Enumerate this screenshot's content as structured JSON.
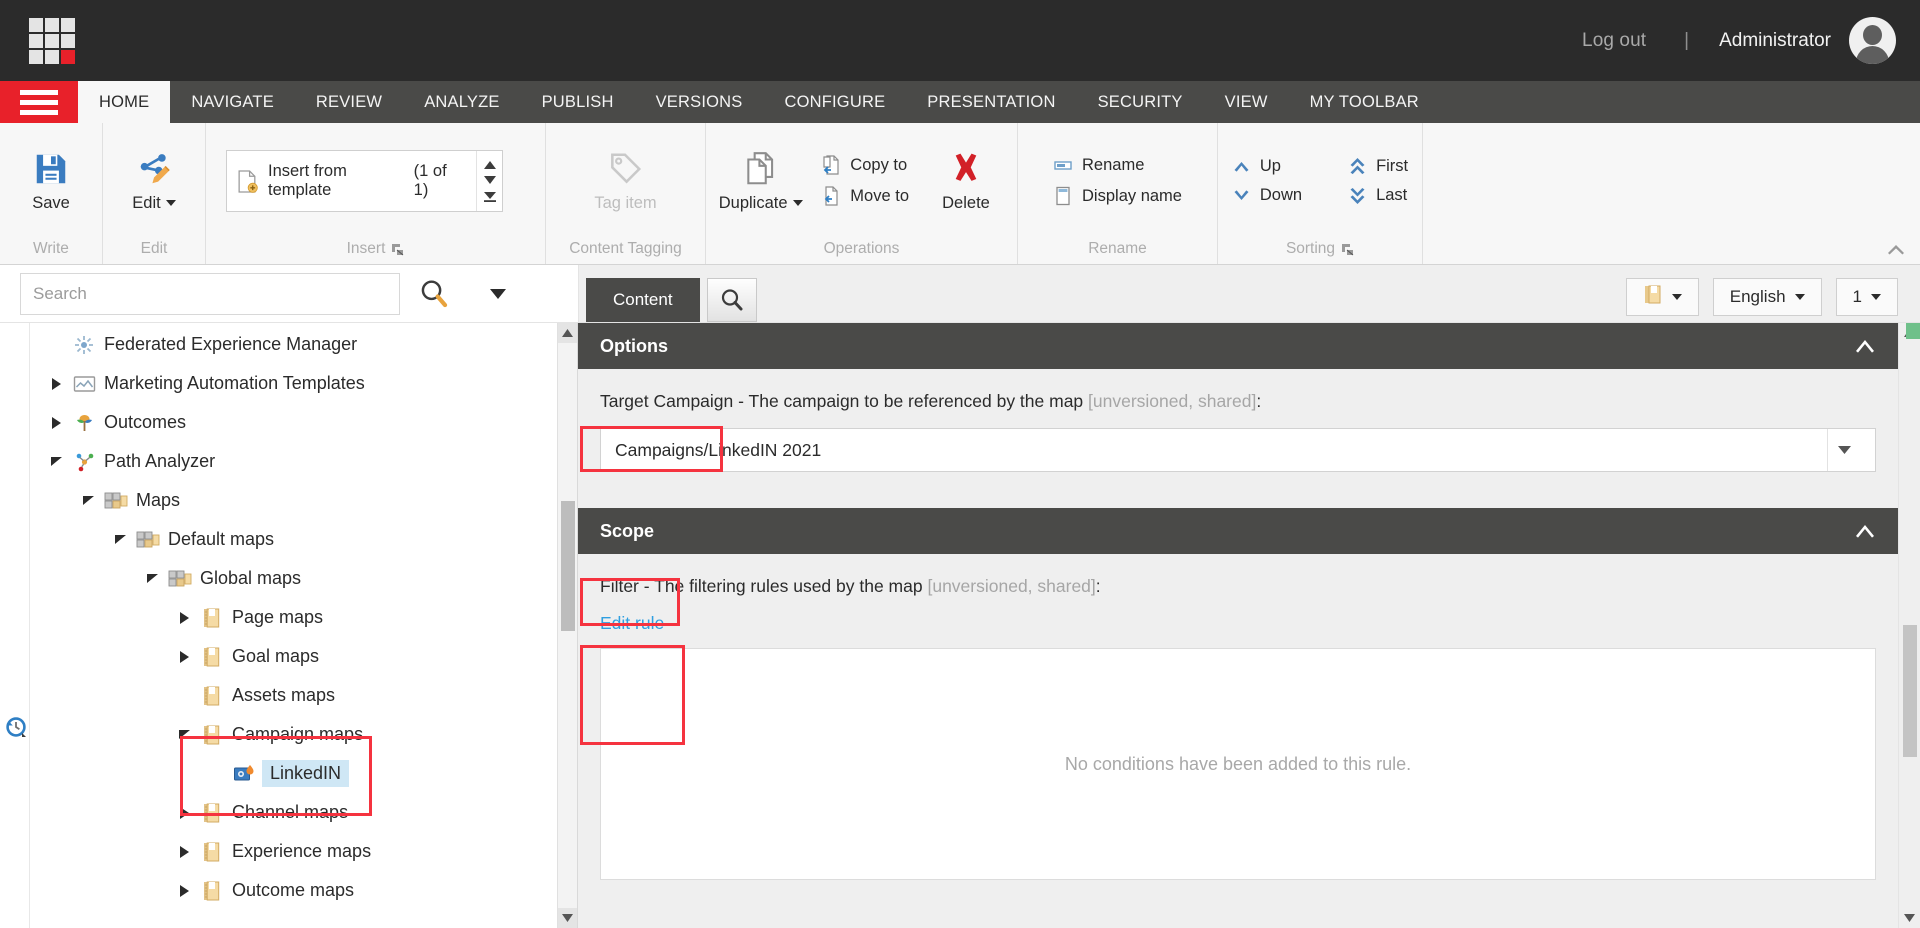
{
  "topbar": {
    "logo_name": "sitecore-logo",
    "logout_label": "Log out",
    "separator": "|",
    "user_label": "Administrator"
  },
  "ribbon_tabs": [
    {
      "label": "HOME",
      "active": true
    },
    {
      "label": "NAVIGATE",
      "active": false
    },
    {
      "label": "REVIEW",
      "active": false
    },
    {
      "label": "ANALYZE",
      "active": false
    },
    {
      "label": "PUBLISH",
      "active": false
    },
    {
      "label": "VERSIONS",
      "active": false
    },
    {
      "label": "CONFIGURE",
      "active": false
    },
    {
      "label": "PRESENTATION",
      "active": false
    },
    {
      "label": "SECURITY",
      "active": false
    },
    {
      "label": "VIEW",
      "active": false
    },
    {
      "label": "MY TOOLBAR",
      "active": false
    }
  ],
  "ribbon": {
    "write": {
      "group_label": "Write",
      "save_label": "Save"
    },
    "edit": {
      "group_label": "Edit",
      "edit_label": "Edit"
    },
    "insert": {
      "group_label": "Insert",
      "template_label": "Insert from template",
      "counter": "(1 of 1)"
    },
    "content_tagging": {
      "group_label": "Content Tagging",
      "tag_item_label": "Tag item"
    },
    "operations": {
      "group_label": "Operations",
      "duplicate_label": "Duplicate",
      "copy_to_label": "Copy to",
      "move_to_label": "Move to",
      "delete_label": "Delete"
    },
    "rename": {
      "group_label": "Rename",
      "rename_label": "Rename",
      "display_name_label": "Display name"
    },
    "sorting": {
      "group_label": "Sorting",
      "up_label": "Up",
      "down_label": "Down",
      "first_label": "First",
      "last_label": "Last"
    }
  },
  "search": {
    "placeholder": "Search",
    "value": ""
  },
  "content_tabs": {
    "content_label": "Content",
    "search_icon": "search-icon"
  },
  "header_controls": {
    "item_dropdown": "",
    "language_label": "English",
    "version_label": "1"
  },
  "tree": {
    "items": [
      {
        "label": "Federated Experience Manager",
        "depth": 1,
        "twist": "none",
        "icon": "fxm-icon",
        "selected": false
      },
      {
        "label": "Marketing Automation Templates",
        "depth": 1,
        "twist": "collapsed",
        "icon": "ma-icon",
        "selected": false
      },
      {
        "label": "Outcomes",
        "depth": 1,
        "twist": "collapsed",
        "icon": "outcomes-icon",
        "selected": false
      },
      {
        "label": "Path Analyzer",
        "depth": 1,
        "twist": "expanded",
        "icon": "path-icon",
        "selected": false
      },
      {
        "label": "Maps",
        "depth": 2,
        "twist": "expanded",
        "icon": "maps-icon",
        "selected": false
      },
      {
        "label": "Default maps",
        "depth": 3,
        "twist": "expanded",
        "icon": "maps-icon",
        "selected": false
      },
      {
        "label": "Global maps",
        "depth": 4,
        "twist": "expanded",
        "icon": "maps-icon",
        "selected": false
      },
      {
        "label": "Page maps",
        "depth": 5,
        "twist": "collapsed",
        "icon": "folder-icon",
        "selected": false
      },
      {
        "label": "Goal maps",
        "depth": 5,
        "twist": "collapsed",
        "icon": "folder-icon",
        "selected": false
      },
      {
        "label": "Assets maps",
        "depth": 5,
        "twist": "none",
        "icon": "folder-icon",
        "selected": false
      },
      {
        "label": "Campaign maps",
        "depth": 5,
        "twist": "expanded",
        "icon": "folder-icon",
        "selected": false
      },
      {
        "label": "LinkedIN",
        "depth": 6,
        "twist": "none",
        "icon": "map-item-icon",
        "selected": true
      },
      {
        "label": "Channel maps",
        "depth": 5,
        "twist": "collapsed",
        "icon": "folder-icon",
        "selected": false
      },
      {
        "label": "Experience maps",
        "depth": 5,
        "twist": "collapsed",
        "icon": "folder-icon",
        "selected": false
      },
      {
        "label": "Outcome maps",
        "depth": 5,
        "twist": "collapsed",
        "icon": "folder-icon",
        "selected": false
      }
    ]
  },
  "options_section": {
    "title": "Options",
    "field_name": "Target Campaign - ",
    "field_desc": "The campaign to be referenced by the map ",
    "field_meta": "[unversioned, shared]",
    "field_colon": ":",
    "campaign_value": "Campaigns/LinkedIN 2021"
  },
  "scope_section": {
    "title": "Scope",
    "field_name": "Filter - ",
    "field_desc": "The filtering rules used by the map ",
    "field_meta": "[unversioned, shared]",
    "field_colon": ":",
    "edit_rule_label": "Edit rule",
    "empty_rule_text": "No conditions have been added to this rule."
  },
  "colors": {
    "brand_red": "#e8212a",
    "dark_chrome": "#2b2b2b",
    "ribbon_dark": "#4a4a48",
    "accent_blue": "#2f9fe0",
    "highlight_box": "#f5333f",
    "selection_blue": "#cfe7f5"
  }
}
